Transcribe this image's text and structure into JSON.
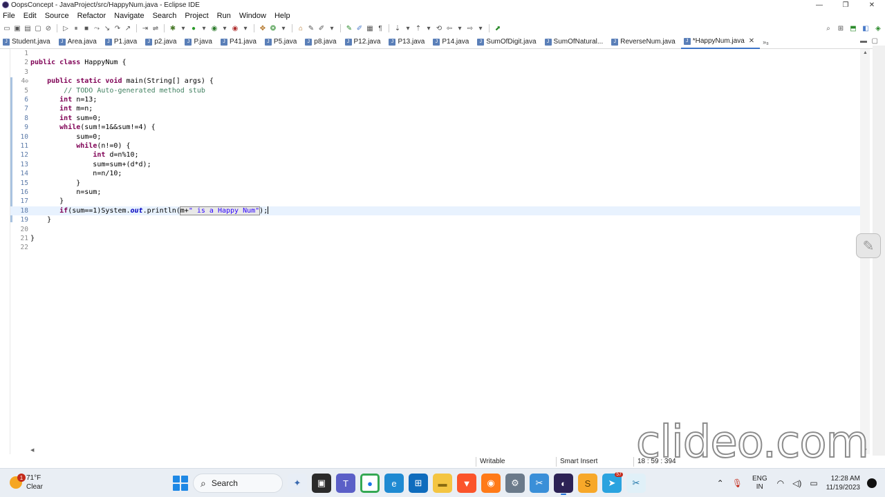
{
  "window": {
    "title": "OopsConcept - JavaProject/src/HappyNum.java - Eclipse IDE",
    "minimize": "—",
    "maximize": "❐",
    "close": "✕"
  },
  "menu": [
    "File",
    "Edit",
    "Source",
    "Refactor",
    "Navigate",
    "Search",
    "Project",
    "Run",
    "Window",
    "Help"
  ],
  "tabs": [
    {
      "label": "Student.java",
      "active": false
    },
    {
      "label": "Area.java",
      "active": false
    },
    {
      "label": "P1.java",
      "active": false
    },
    {
      "label": "p2.java",
      "active": false
    },
    {
      "label": "P.java",
      "active": false
    },
    {
      "label": "P41.java",
      "active": false
    },
    {
      "label": "P5.java",
      "active": false
    },
    {
      "label": "p8.java",
      "active": false
    },
    {
      "label": "P12.java",
      "active": false
    },
    {
      "label": "P13.java",
      "active": false
    },
    {
      "label": "P14.java",
      "active": false
    },
    {
      "label": "SumOfDigit.java",
      "active": false
    },
    {
      "label": "SumOfNatural...",
      "active": false
    },
    {
      "label": "ReverseNum.java",
      "active": false
    },
    {
      "label": "*HappyNum.java",
      "active": true
    }
  ],
  "tabs_overflow": "»₈",
  "editor": {
    "lines": [
      "1",
      "2",
      "3",
      "4",
      "5",
      "6",
      "7",
      "8",
      "9",
      "10",
      "11",
      "12",
      "13",
      "14",
      "15",
      "16",
      "17",
      "18",
      "19",
      "20",
      "21",
      "22"
    ],
    "fold_marker": "⊖"
  },
  "status": {
    "writable": "Writable",
    "insert_mode": "Smart Insert",
    "position": "18 : 59 : 394"
  },
  "watermark": "clideo.com",
  "taskbar": {
    "weather_temp": "71°F",
    "weather_desc": "Clear",
    "weather_badge": "1",
    "search_label": "Search",
    "telegram_badge": "57",
    "lang_top": "ENG",
    "lang_bottom": "IN",
    "time": "12:28 AM",
    "date": "11/19/2023"
  },
  "colors": {
    "keyword": "#7f0055",
    "comment": "#3f7f5f",
    "string": "#2a00ff",
    "field": "#0000c0",
    "current_line": "#e8f2fe"
  }
}
